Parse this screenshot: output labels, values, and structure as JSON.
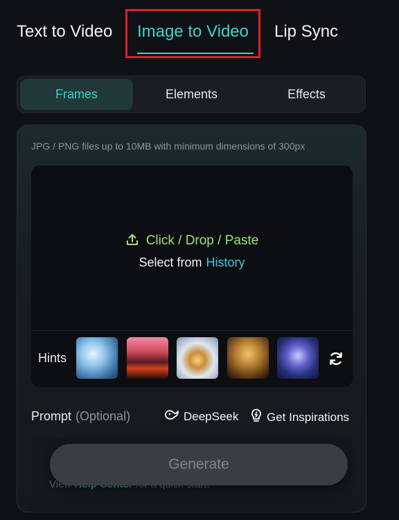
{
  "top_tabs": [
    {
      "label": "Text to Video"
    },
    {
      "label": "Image to Video"
    },
    {
      "label": "Lip Sync"
    }
  ],
  "active_top_tab": "Image to Video",
  "sub_tabs": [
    {
      "label": "Frames"
    },
    {
      "label": "Elements"
    },
    {
      "label": "Effects"
    }
  ],
  "active_sub_tab": "Frames",
  "upload": {
    "note": "JPG / PNG files up to 10MB with minimum dimensions of 300px",
    "action": "Click / Drop / Paste",
    "select_prefix": "Select from",
    "history_link": "History"
  },
  "hints": {
    "label": "Hints",
    "thumbnails": [
      "hint-ocean-figure",
      "hint-lava-sunset",
      "hint-snow-cabin",
      "hint-guitar-woman",
      "hint-astronaut-space"
    ]
  },
  "prompt": {
    "label": "Prompt",
    "optional": "(Optional)",
    "deepseek": "DeepSeek",
    "inspirations": "Get Inspirations",
    "help_prefix": "View",
    "help_link": "Help Center",
    "help_suffix": "for a quick start."
  },
  "generate_label": "Generate",
  "colors": {
    "accent": "#41d3d3",
    "upload_green": "#9be37a",
    "highlight_red": "#e01e2a"
  }
}
